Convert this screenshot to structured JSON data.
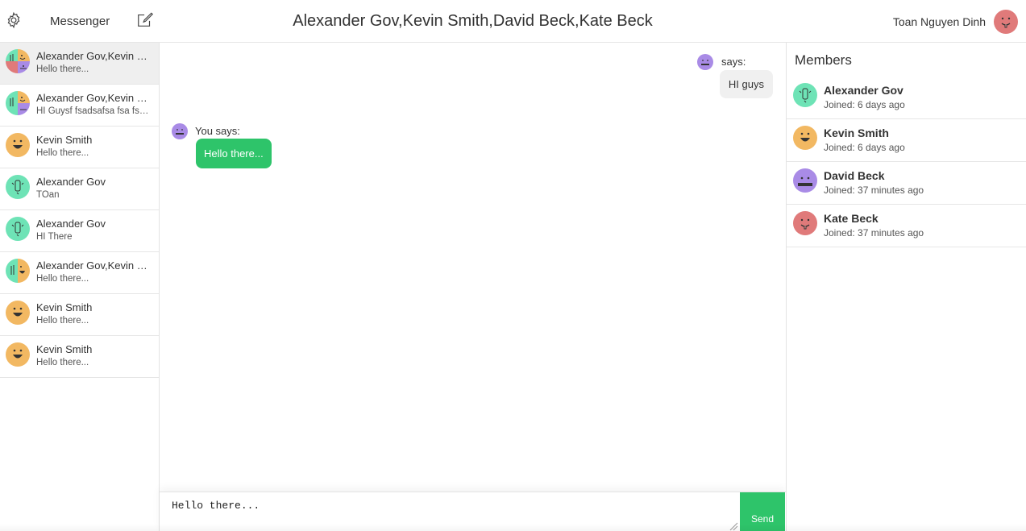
{
  "header": {
    "app_title": "Messenger",
    "conversation_title": "Alexander Gov,Kevin Smith,David Beck,Kate Beck",
    "current_user": "Toan Nguyen Dinh",
    "current_user_avatar_color": "#e07a7a"
  },
  "icons": {
    "settings": "gear-icon",
    "compose": "compose-icon"
  },
  "colors": {
    "accent_green": "#2ec46a",
    "bubble_gray": "#f0f0f0",
    "avatar_teal": "#6ee3b6",
    "avatar_orange": "#f2b862",
    "avatar_purple": "#a98be6",
    "avatar_red": "#e07a7a"
  },
  "conversations": [
    {
      "name": "Alexander Gov,Kevin Smith,David Beck,Kate Beck",
      "preview": "Hello there...",
      "active": true,
      "avatar": "group-4"
    },
    {
      "name": "Alexander Gov,Kevin Smith,David Beck",
      "preview": "HI Guysf fsadsafsa fsa fsa fsa",
      "active": false,
      "avatar": "group-3"
    },
    {
      "name": "Kevin Smith",
      "preview": "Hello there...",
      "active": false,
      "avatar": "orange"
    },
    {
      "name": "Alexander Gov",
      "preview": "TOan",
      "active": false,
      "avatar": "teal"
    },
    {
      "name": "Alexander Gov",
      "preview": "HI There",
      "active": false,
      "avatar": "teal"
    },
    {
      "name": "Alexander Gov,Kevin Smith",
      "preview": "Hello there...",
      "active": false,
      "avatar": "group-2"
    },
    {
      "name": "Kevin Smith",
      "preview": "Hello there...",
      "active": false,
      "avatar": "orange"
    },
    {
      "name": "Kevin Smith",
      "preview": "Hello there...",
      "active": false,
      "avatar": "orange"
    }
  ],
  "messages": [
    {
      "sender_label": "says:",
      "text": "HI guys",
      "side": "right",
      "avatar": "purple"
    },
    {
      "sender_label": "You says:",
      "text": "Hello there...",
      "side": "left",
      "avatar": "purple"
    }
  ],
  "composer": {
    "value": "Hello there...",
    "send_label": "Send"
  },
  "members_panel": {
    "heading": "Members",
    "members": [
      {
        "name": "Alexander Gov",
        "joined": "Joined: 6 days ago",
        "avatar": "teal"
      },
      {
        "name": "Kevin Smith",
        "joined": "Joined: 6 days ago",
        "avatar": "orange"
      },
      {
        "name": "David Beck",
        "joined": "Joined: 37 minutes ago",
        "avatar": "purple"
      },
      {
        "name": "Kate Beck",
        "joined": "Joined: 37 minutes ago",
        "avatar": "red"
      }
    ]
  }
}
